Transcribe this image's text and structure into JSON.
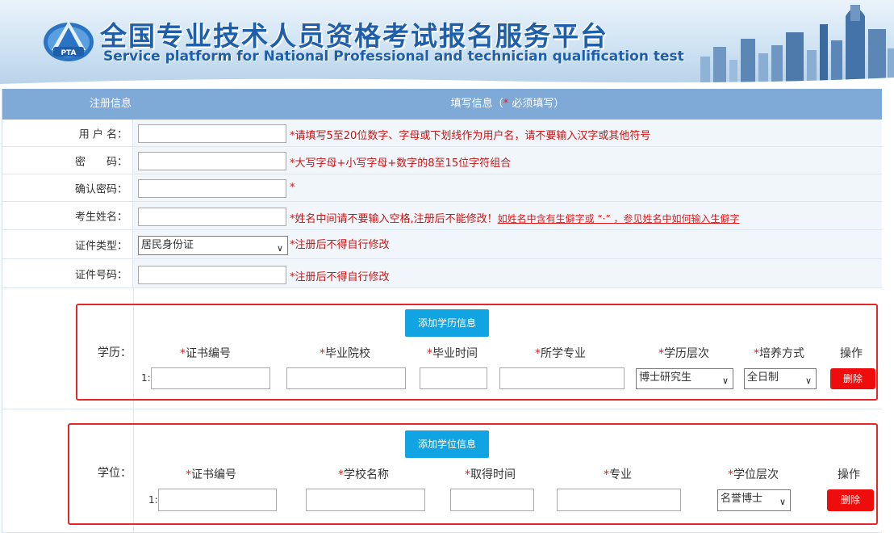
{
  "banner": {
    "title": "全国专业技术人员资格考试报名服务平台",
    "subtitle": "Service platform for National Professional and technician  qualification test",
    "logo_text": "PTA"
  },
  "table_header": {
    "left": "注册信息",
    "right_prefix": "填写信息（",
    "right_star": "*",
    "right_suffix": " 必须填写）"
  },
  "fields": {
    "username": {
      "label": "用 户 名：",
      "value": "",
      "hint": "*请填写5至20位数字、字母或下划线作为用户名，请不要输入汉字或其他符号"
    },
    "password": {
      "label": "密　　码：",
      "value": "",
      "hint": "*大写字母+小写字母+数字的8至15位字符组合"
    },
    "confirm_password": {
      "label": "确认密码：",
      "value": "",
      "hint": "*"
    },
    "name": {
      "label": "考生姓名：",
      "value": "",
      "hint": "*姓名中间请不要输入空格,注册后不能修改！",
      "link": "如姓名中含有生僻字或 “·” ，参见姓名中如何输入生僻字"
    },
    "id_type": {
      "label": "证件类型：",
      "selected": "居民身份证",
      "hint": "*注册后不得自行修改"
    },
    "id_number": {
      "label": "证件号码：",
      "value": "",
      "hint": "*注册后不得自行修改"
    }
  },
  "education": {
    "label": "学历：",
    "add_button": "添加学历信息",
    "columns": [
      "证书编号",
      "毕业院校",
      "毕业时间",
      "所学专业",
      "学历层次",
      "培养方式"
    ],
    "star": "*",
    "op_header": "操作",
    "row_index": "1:",
    "level_selected": "博士研究生",
    "mode_selected": "全日制",
    "delete_button": "删除"
  },
  "degree": {
    "label": "学位：",
    "add_button": "添加学位信息",
    "columns": [
      "证书编号",
      "学校名称",
      "取得时间",
      "专业",
      "学位层次"
    ],
    "star": "*",
    "op_header": "操作",
    "row_index": "1:",
    "level_selected": "名誉博士",
    "delete_button": "删除"
  },
  "colors": {
    "header_bg": "#7fa9d6",
    "accent_blue": "#10a4e2",
    "danger_red": "#ee0c0c",
    "hint_red": "#c81414"
  }
}
